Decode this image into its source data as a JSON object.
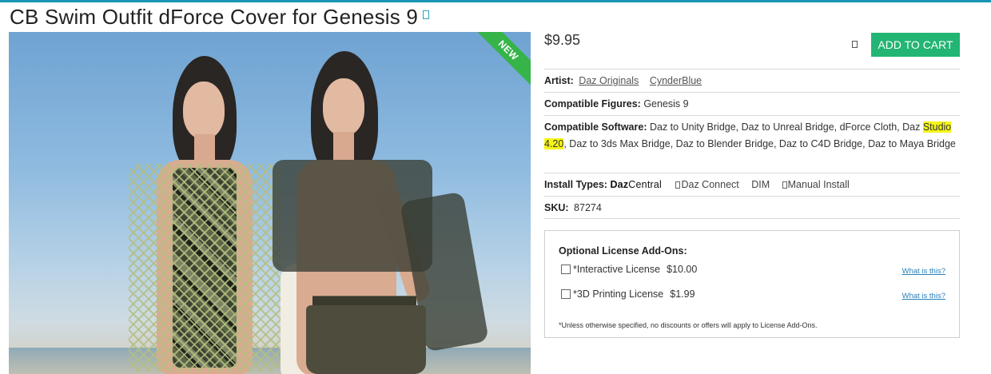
{
  "product": {
    "title": "CB Swim Outfit dForce Cover for Genesis 9",
    "badge": "NEW",
    "price": "$9.95",
    "add_to_cart_label": "ADD TO CART"
  },
  "details": {
    "artist_label": "Artist:",
    "artists": [
      "Daz Originals",
      "CynderBlue"
    ],
    "figures_label": "Compatible Figures:",
    "figures": "Genesis 9",
    "software_label": "Compatible Software:",
    "software_before": "Daz to Unity Bridge, Daz to Unreal Bridge, dForce Cloth, Daz",
    "software_highlight": "Studio 4.20",
    "software_after": ", Daz to 3ds Max Bridge, Daz to Blender Bridge, Daz to C4D Bridge, Daz to Maya Bridge",
    "install_label": "Install Types:",
    "install_logo_bold": "Daz",
    "install_logo_light": "Central",
    "install_types": [
      "Daz Connect",
      "DIM",
      "Manual Install"
    ],
    "sku_label": "SKU:",
    "sku": "87274"
  },
  "licenses": {
    "title": "Optional License Add-Ons:",
    "items": [
      {
        "name": "*Interactive License",
        "price": "$10.00",
        "help": "What is this?"
      },
      {
        "name": "*3D Printing License",
        "price": "$1.99",
        "help": "What is this?"
      }
    ],
    "note": "*Unless otherwise specified, no discounts or offers will apply to License Add-Ons."
  },
  "colors": {
    "accent": "#1795b3",
    "cart_button": "#22b573",
    "new_badge": "#36b44a",
    "highlight": "#f5f51a"
  },
  "icons": {
    "title_icon": "external-link-icon",
    "wishlist_icon": "wishlist-icon"
  }
}
